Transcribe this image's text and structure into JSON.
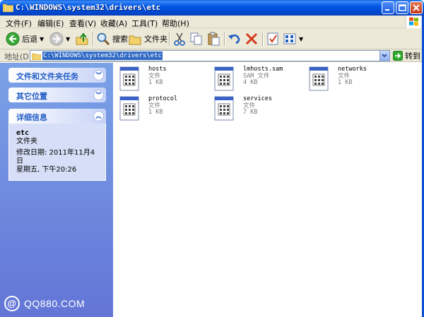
{
  "window": {
    "title": "C:\\WINDOWS\\system32\\drivers\\etc"
  },
  "menu": [
    "文件(F)",
    "编辑(E)",
    "查看(V)",
    "收藏(A)",
    "工具(T)",
    "帮助(H)"
  ],
  "toolbar": {
    "back": "后退",
    "search": "搜索",
    "folders": "文件夹"
  },
  "address": {
    "label": "地址(D)",
    "value": "C:\\WINDOWS\\system32\\drivers\\etc",
    "go": "转到"
  },
  "sidebar": {
    "tasks": "文件和文件夹任务",
    "other": "其它位置",
    "details": {
      "title": "详细信息",
      "name": "etc",
      "type": "文件夹",
      "modified": "修改日期: 2011年11月4日",
      "modified2": "星期五, 下午20:26"
    }
  },
  "files": [
    {
      "name": "hosts",
      "type": "文件",
      "size": "1 KB"
    },
    {
      "name": "lmhosts.sam",
      "type": "SAM 文件",
      "size": "4 KB"
    },
    {
      "name": "networks",
      "type": "文件",
      "size": "1 KB"
    },
    {
      "name": "protocol",
      "type": "文件",
      "size": "1 KB"
    },
    {
      "name": "services",
      "type": "文件",
      "size": "7 KB"
    }
  ],
  "watermark": "QQ880.COM",
  "icons": [
    "folder-icon",
    "back-icon",
    "forward-icon",
    "up-icon",
    "search-icon",
    "folders-icon",
    "cut-icon",
    "copy-icon",
    "paste-icon",
    "undo-icon",
    "delete-icon",
    "properties-icon",
    "views-icon",
    "go-icon",
    "file-icon",
    "windows-logo-icon"
  ],
  "colors": {
    "titlebar": "#0055e5",
    "sidebar": "#6d8ce0",
    "selection": "#316ac5"
  }
}
